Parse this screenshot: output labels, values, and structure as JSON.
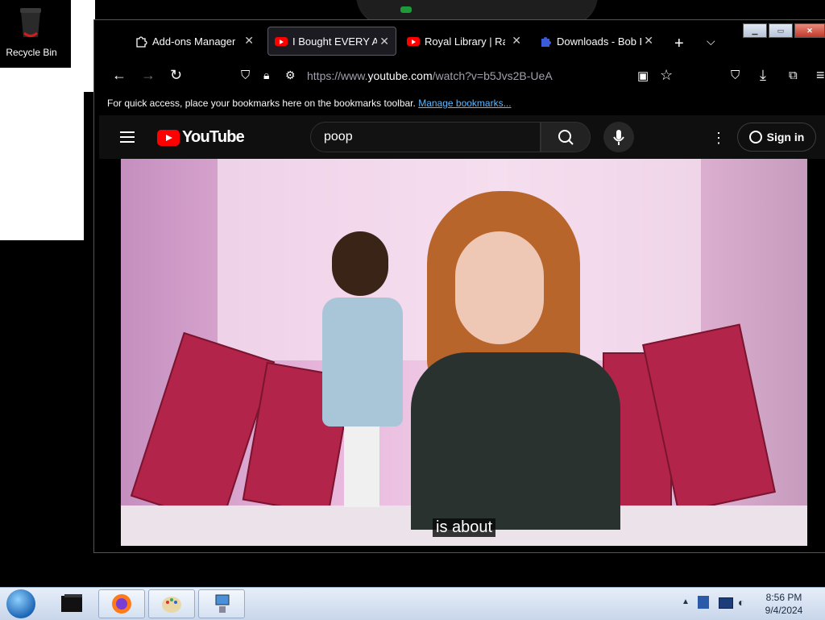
{
  "desktop": {
    "recycle_bin_label": "Recycle Bin"
  },
  "browser": {
    "tabs": [
      {
        "title": "Add-ons Manager",
        "active": false,
        "icon": "puzzle-icon"
      },
      {
        "title": "I Bought EVERY Am",
        "active": true,
        "icon": "youtube-icon"
      },
      {
        "title": "Royal Library | Rain",
        "active": false,
        "icon": "youtube-icon"
      },
      {
        "title": "Downloads - Bob P",
        "active": false,
        "icon": "download-puzzle-icon"
      }
    ],
    "new_tab": "+",
    "url_prefix": "https://www.",
    "url_domain": "youtube.com",
    "url_rest": "/watch?v=b5Jvs2B-UeA",
    "bookmarks_hint": "For quick access, place your bookmarks here on the bookmarks toolbar.",
    "manage_bookmarks": "Manage bookmarks..."
  },
  "youtube": {
    "logo_text": "YouTube",
    "search_value": "poop",
    "sign_in": "Sign in",
    "caption": "is about"
  },
  "taskbar": {
    "time": "8:56 PM",
    "date": "9/4/2024"
  },
  "colors": {
    "browser_bg": "#000000",
    "youtube_red": "#ff0000",
    "link_blue": "#5cb8ff"
  }
}
